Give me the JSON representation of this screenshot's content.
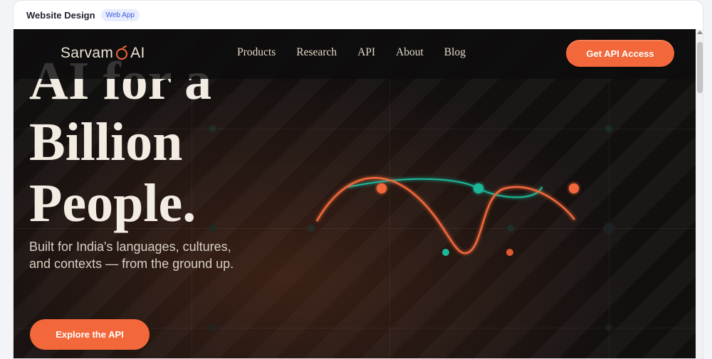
{
  "frame": {
    "title": "Website Design",
    "badge": "Web App"
  },
  "navbar": {
    "logo_text_left": "Sarvam",
    "logo_text_right": "AI",
    "links": [
      "Products",
      "Research",
      "API",
      "About",
      "Blog"
    ],
    "cta_label": "Get API Access"
  },
  "hero": {
    "headline_lines": [
      "AI for a",
      "Billion",
      "People."
    ],
    "subtitle": "Built for India's languages, cultures, and contexts — from the ground up.",
    "cta_label": "Explore the API"
  },
  "colors": {
    "accent": "#f2683a",
    "teal": "#1bb89a",
    "background": "#120f0f",
    "text": "#f3ece2"
  },
  "icons": {
    "logo_mark": "sarvam-logo-mark-icon"
  }
}
